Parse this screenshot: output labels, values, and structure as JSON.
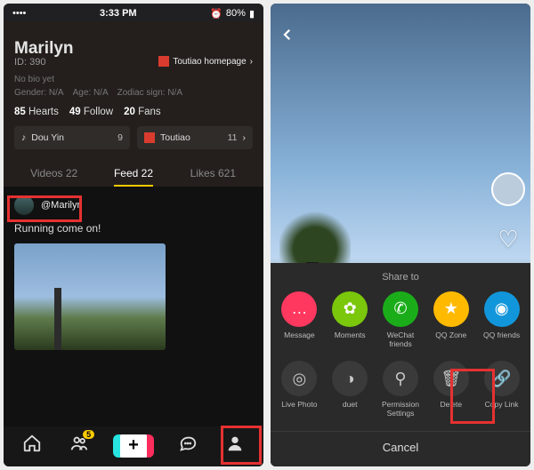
{
  "status": {
    "carrier": "•••",
    "wifi": "wifi",
    "time": "3:33 PM",
    "alarm": "⏰",
    "battery": "80%"
  },
  "profile": {
    "name": "Marilyn",
    "id_prefix": "ID: 390",
    "homepage_label": "Toutiao homepage",
    "nobio": "No bio yet",
    "gender": "Gender: N/A",
    "age": "Age: N/A",
    "zodiac": "Zodiac sign: N/A",
    "hearts": {
      "n": "85",
      "label": "Hearts"
    },
    "follow": {
      "n": "49",
      "label": "Follow"
    },
    "fans": {
      "n": "20",
      "label": "Fans"
    },
    "apps": [
      {
        "label": "Dou Yin",
        "count": "9"
      },
      {
        "label": "Toutiao",
        "count": "11",
        "chev": "›"
      }
    ]
  },
  "tabs": {
    "videos": "Videos 22",
    "feed": "Feed 22",
    "likes": "Likes 621"
  },
  "post": {
    "user": "@Marilyn",
    "caption": "Running come on!"
  },
  "nav_badge": "5",
  "share": {
    "title": "Share to",
    "row1": [
      {
        "label": "Message",
        "color": "#ff3860",
        "glyph": "…"
      },
      {
        "label": "Moments",
        "color": "#7ac70c",
        "glyph": "✿"
      },
      {
        "label": "WeChat friends",
        "color": "#1aad19",
        "glyph": "✆"
      },
      {
        "label": "QQ Zone",
        "color": "#ffba00",
        "glyph": "★"
      },
      {
        "label": "QQ friends",
        "color": "#1296db",
        "glyph": "◉"
      }
    ],
    "row2": [
      {
        "label": "Live Photo",
        "glyph": "◎"
      },
      {
        "label": "duet",
        "glyph": "◑"
      },
      {
        "label": "Permission Settings",
        "glyph": "⚲"
      },
      {
        "label": "Delete",
        "glyph": "🗑"
      },
      {
        "label": "Copy Link",
        "glyph": "🔗"
      }
    ],
    "cancel": "Cancel"
  }
}
